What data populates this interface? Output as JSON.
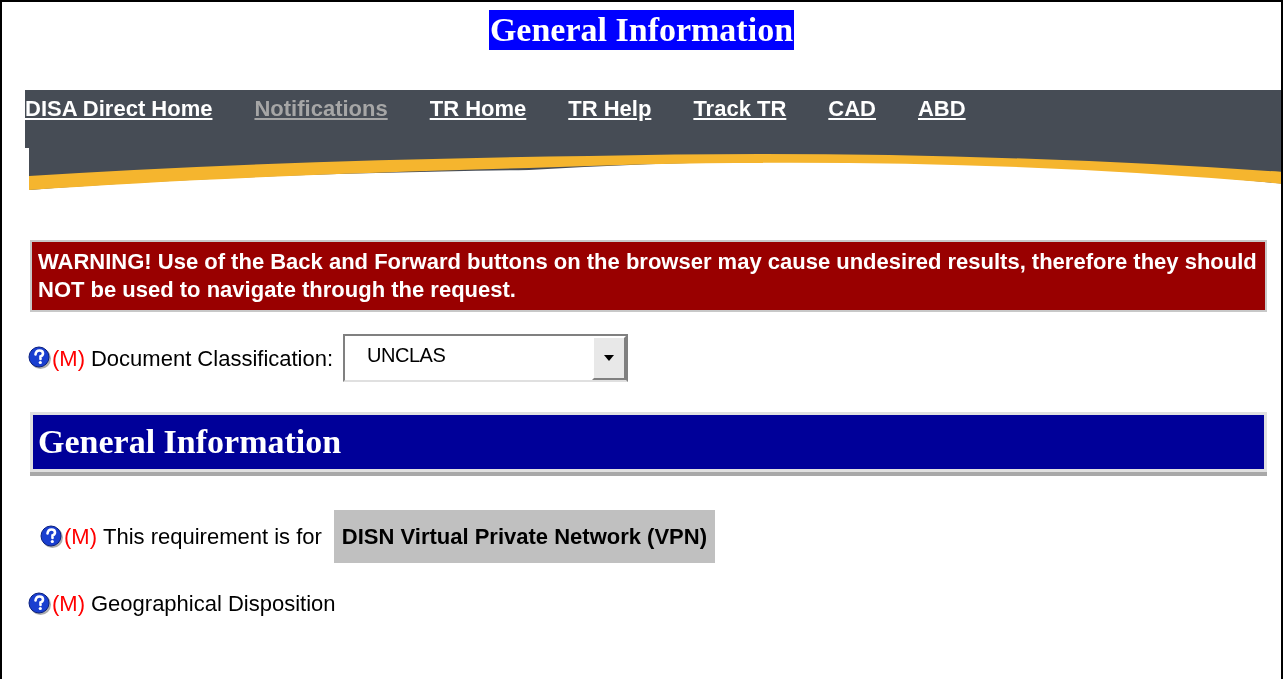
{
  "page_title": "General Information",
  "nav_links": [
    {
      "label": "DISA Direct Home",
      "disabled": false
    },
    {
      "label": "Notifications",
      "disabled": true
    },
    {
      "label": "TR Home",
      "disabled": false
    },
    {
      "label": "TR Help",
      "disabled": false
    },
    {
      "label": "Track TR",
      "disabled": false
    },
    {
      "label": "CAD",
      "disabled": false
    },
    {
      "label": "ABD",
      "disabled": false
    }
  ],
  "warning": "WARNING! Use of the Back and Forward buttons on the browser may cause undesired results, therefore they should NOT be used to navigate through the request.",
  "classification": {
    "mandatory_mark": "(M)",
    "label": "Document Classification:",
    "value": "UNCLAS"
  },
  "section": {
    "title": "General Information",
    "fields": [
      {
        "kind": "value",
        "mandatory_mark": "(M)",
        "label": "This requirement is for",
        "value": "DISN Virtual Private Network (VPN)"
      },
      {
        "kind": "heading",
        "mandatory_mark": "(M)",
        "label": "Geographical Disposition"
      }
    ]
  }
}
